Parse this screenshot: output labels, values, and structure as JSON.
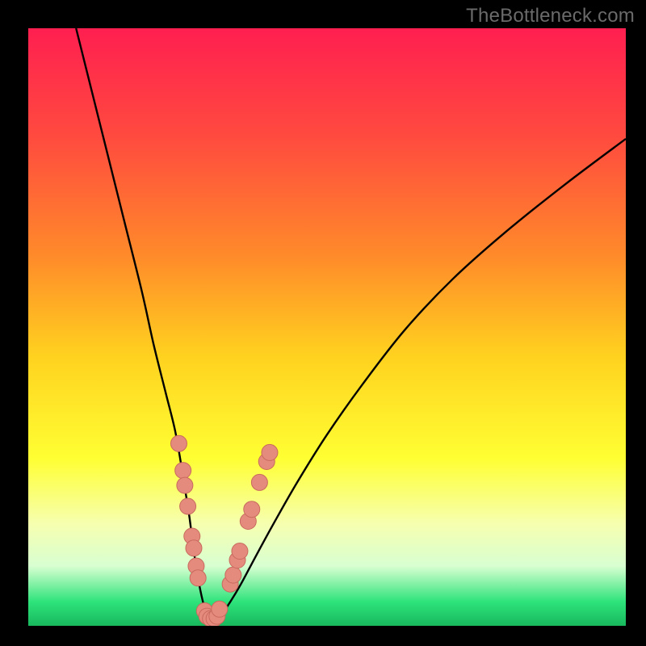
{
  "watermark": "TheBottleneck.com",
  "chart_data": {
    "type": "line",
    "title": "",
    "xlabel": "",
    "ylabel": "",
    "xlim": [
      0,
      100
    ],
    "ylim": [
      0,
      100
    ],
    "gradient_stops": [
      {
        "offset": 0.0,
        "color": "#ff1f50"
      },
      {
        "offset": 0.18,
        "color": "#ff4a3f"
      },
      {
        "offset": 0.38,
        "color": "#ff8a2a"
      },
      {
        "offset": 0.55,
        "color": "#ffd21f"
      },
      {
        "offset": 0.72,
        "color": "#ffff33"
      },
      {
        "offset": 0.83,
        "color": "#f6ffb0"
      },
      {
        "offset": 0.9,
        "color": "#d8ffd1"
      },
      {
        "offset": 0.96,
        "color": "#2de37a"
      },
      {
        "offset": 1.0,
        "color": "#19b85e"
      }
    ],
    "series": [
      {
        "name": "bottleneck-curve",
        "x": [
          8,
          12,
          16,
          19,
          21,
          23,
          24.5,
          25.5,
          26.3,
          27,
          27.5,
          28,
          28.5,
          29,
          29.5,
          30,
          30.6,
          31.4,
          32.4,
          33.8,
          35.6,
          38,
          41,
          45,
          50,
          56,
          63,
          71,
          80,
          90,
          100
        ],
        "y": [
          100,
          84,
          68,
          56,
          47,
          39,
          33,
          27.5,
          22.5,
          18,
          14,
          10.5,
          7.5,
          5,
          3,
          1.5,
          1,
          1,
          2,
          4,
          7,
          11.5,
          17,
          24,
          32,
          40.5,
          49.5,
          58,
          66,
          74,
          81.5
        ]
      }
    ],
    "markers": [
      {
        "x": 25.2,
        "y": 30.5
      },
      {
        "x": 25.9,
        "y": 26.0
      },
      {
        "x": 26.2,
        "y": 23.5
      },
      {
        "x": 26.7,
        "y": 20.0
      },
      {
        "x": 27.4,
        "y": 15.0
      },
      {
        "x": 27.7,
        "y": 13.0
      },
      {
        "x": 28.1,
        "y": 10.0
      },
      {
        "x": 28.4,
        "y": 8.0
      },
      {
        "x": 29.5,
        "y": 2.5
      },
      {
        "x": 29.9,
        "y": 1.6
      },
      {
        "x": 30.5,
        "y": 1.2
      },
      {
        "x": 31.1,
        "y": 1.2
      },
      {
        "x": 31.6,
        "y": 1.6
      },
      {
        "x": 32.0,
        "y": 2.8
      },
      {
        "x": 33.8,
        "y": 7.0
      },
      {
        "x": 34.3,
        "y": 8.5
      },
      {
        "x": 35.0,
        "y": 11.0
      },
      {
        "x": 35.4,
        "y": 12.5
      },
      {
        "x": 36.8,
        "y": 17.5
      },
      {
        "x": 37.4,
        "y": 19.5
      },
      {
        "x": 38.7,
        "y": 24.0
      },
      {
        "x": 39.9,
        "y": 27.5
      },
      {
        "x": 40.4,
        "y": 29.0
      }
    ],
    "marker_radius": 10,
    "curve_stroke": "#000000",
    "marker_fill": "#e58b7e",
    "marker_stroke": "#c86a5d"
  }
}
